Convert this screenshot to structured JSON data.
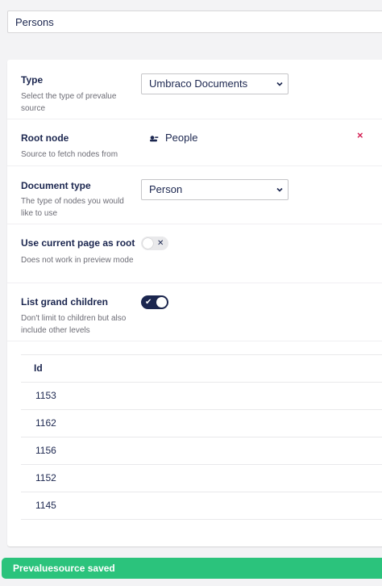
{
  "name_field": {
    "value": "Persons"
  },
  "type": {
    "label": "Type",
    "description": "Select the type of prevalue source",
    "selected": "Umbraco Documents"
  },
  "root_node": {
    "label": "Root node",
    "description": "Source to fetch nodes from",
    "node_name": "People",
    "remove_glyph": "×"
  },
  "document_type": {
    "label": "Document type",
    "description": "The type of nodes you would like to use",
    "selected": "Person"
  },
  "use_current_page": {
    "label": "Use current page as root",
    "description": "Does not work in preview mode",
    "enabled": false,
    "glyph": "✕"
  },
  "list_grand_children": {
    "label": "List grand children",
    "description": "Don't limit to children but also include other levels",
    "enabled": true,
    "glyph": "✔"
  },
  "table": {
    "header": "Id",
    "rows": [
      "1153",
      "1162",
      "1156",
      "1152",
      "1145"
    ]
  },
  "toast": {
    "message": "Prevaluesource saved",
    "color": "#2bc37c"
  },
  "colors": {
    "primary": "#1b264f",
    "danger": "#d42054"
  }
}
